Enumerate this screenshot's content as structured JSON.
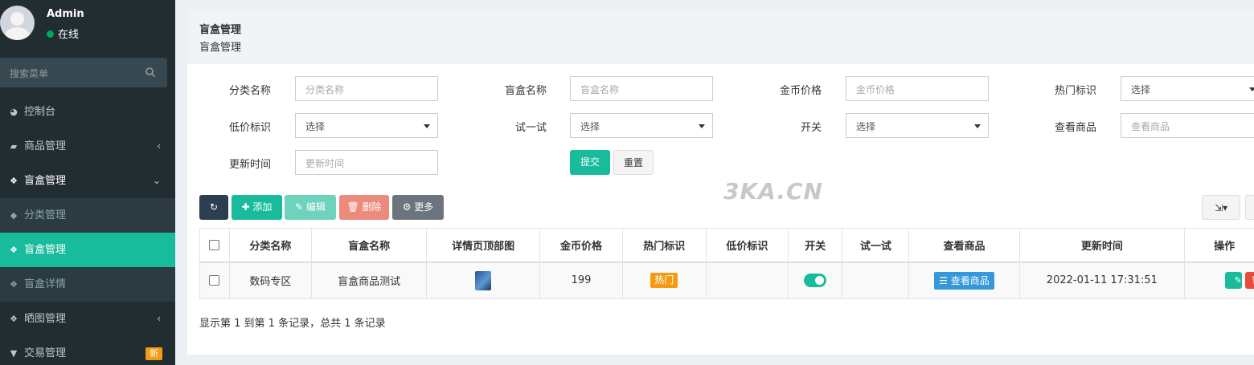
{
  "user": {
    "name": "Admin",
    "status": "在线"
  },
  "search": {
    "placeholder": "搜索菜单"
  },
  "menu": [
    {
      "label": "控制台",
      "icon": "dashboard-icon"
    },
    {
      "label": "商品管理",
      "icon": "shopping-bag-icon"
    },
    {
      "label": "盲盒管理",
      "icon": "dropbox-icon"
    },
    {
      "label": "分类管理",
      "icon": "tags-icon"
    },
    {
      "label": "盲盒管理",
      "icon": "dropbox-icon"
    },
    {
      "label": "盲盒详情",
      "icon": "dropbox-icon"
    },
    {
      "label": "晒图管理",
      "icon": "dropbox-icon"
    },
    {
      "label": "交易管理",
      "icon": "cart-icon",
      "badge": "新"
    }
  ],
  "header": {
    "title": "盲盒管理",
    "subtitle": "盲盒管理"
  },
  "filters": {
    "category_label": "分类名称",
    "category_ph": "分类名称",
    "box_name_label": "盲盒名称",
    "box_name_ph": "盲盒名称",
    "price_label": "金币价格",
    "price_ph": "金币价格",
    "hot_label": "热门标识",
    "hot_value": "选择",
    "lowprice_label": "低价标识",
    "lowprice_value": "选择",
    "try_label": "试一试",
    "try_value": "选择",
    "switch_label": "开关",
    "switch_value": "选择",
    "view_label": "查看商品",
    "view_ph": "查看商品",
    "updated_label": "更新时间",
    "updated_ph": "更新时间",
    "submit": "提交",
    "reset": "重置"
  },
  "toolbar": {
    "add": "添加",
    "edit": "编辑",
    "delete": "删除",
    "more": "更多"
  },
  "watermark": "3KA.CN",
  "table": {
    "headers": [
      "分类名称",
      "盲盒名称",
      "详情页顶部图",
      "金币价格",
      "热门标识",
      "低价标识",
      "开关",
      "试一试",
      "查看商品",
      "更新时间",
      "操作"
    ],
    "rows": [
      {
        "category": "数码专区",
        "name": "盲盒商品测试",
        "price": "199",
        "hot": "热门",
        "switch_on": true,
        "view": "查看商品",
        "updated": "2022-01-11 17:31:51"
      }
    ]
  },
  "footer": {
    "text": "显示第 1 到第 1 条记录，总共 1 条记录"
  }
}
